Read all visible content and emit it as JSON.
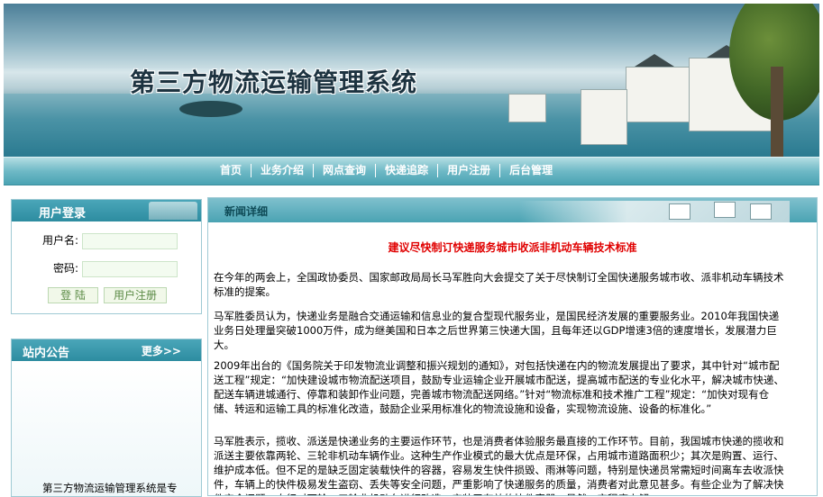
{
  "header": {
    "site_title": "第三方物流运输管理系统"
  },
  "nav": {
    "items": [
      "首页",
      "业务介绍",
      "网点查询",
      "快递追踪",
      "用户注册",
      "后台管理"
    ]
  },
  "login": {
    "title": "用户登录",
    "username_label": "用户名:",
    "password_label": "密码:",
    "login_button": "登 陆",
    "register_button": "用户注册"
  },
  "notice": {
    "title": "站内公告",
    "more": "更多>>",
    "scroll_text": "第三方物流运输管理系统是专"
  },
  "news": {
    "section_title": "新闻详细",
    "article_title": "建议尽快制订快递服务城市收派非机动车辆技术标准",
    "paragraphs": [
      "  在今年的两会上，全国政协委员、国家邮政局局长马军胜向大会提交了关于尽快制订全国快递服务城市收、派非机动车辆技术标准的提案。",
      "      马军胜委员认为，快递业务是融合交通运输和信息业的复合型现代服务业，是国民经济发展的重要服务业。2010年我国快递业务日处理量突破1000万件，成为继美国和日本之后世界第三快递大国，且每年还以GDP增速3倍的速度增长，发展潜力巨大。",
      "      2009年出台的《国务院关于印发物流业调整和振兴规划的通知》，对包括快递在内的物流发展提出了要求，其中针对“城市配送工程”规定：“加快建设城市物流配送项目，鼓励专业运输企业开展城市配送，提高城市配送的专业化水平，解决城市快递、配送车辆进城通行、停靠和装卸作业问题，完善城市物流配送网络。”针对“物流标准和技术推广工程”规定：“加快对现有仓储、转运和运输工具的标准化改造，鼓励企业采用标准化的物流设施和设备，实现物流设施、设备的标准化。”",
      "      马军胜表示，揽收、派送是快递业务的主要运作环节，也是消费者体验服务最直接的工作环节。目前，我国城市快递的揽收和派送主要依靠两轮、三轮非机动车辆作业。这种生产作业模式的最大优点是环保，占用城市道路面积少；其次是购置、运行、维护成本低。但不足的是缺乏固定装载快件的容器，容易发生快件损毁、雨淋等问题，特别是快递员常需短时间离车去收派快件，车辆上的快件极易发生盗窃、丢失等安全问题，严重影响了快递服务的质量，消费者对此意见甚多。有些企业为了解决快件安全问题，自行对两轮、三轮非机动车进行改造，安装了有效的快件容器，虽然一定程度上解"
    ]
  }
}
